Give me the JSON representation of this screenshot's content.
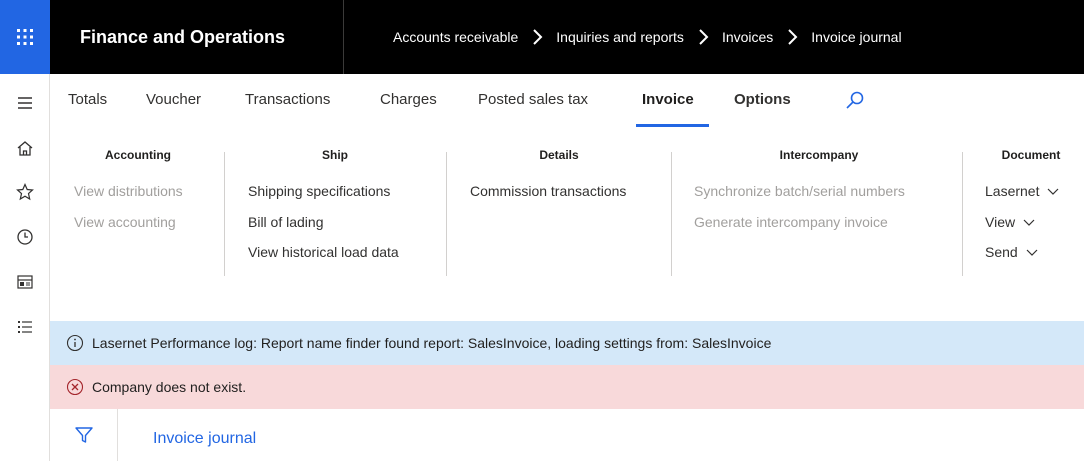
{
  "app": {
    "title": "Finance and Operations"
  },
  "breadcrumb": [
    "Accounts receivable",
    "Inquiries and reports",
    "Invoices",
    "Invoice journal"
  ],
  "tabs": {
    "totals": "Totals",
    "voucher": "Voucher",
    "transactions": "Transactions",
    "charges": "Charges",
    "posted_sales_tax": "Posted sales tax",
    "invoice": "Invoice",
    "options": "Options"
  },
  "groups": {
    "accounting": {
      "title": "Accounting",
      "items": [
        "View distributions",
        "View accounting"
      ]
    },
    "ship": {
      "title": "Ship",
      "items": [
        "Shipping specifications",
        "Bill of lading",
        "View historical load data"
      ]
    },
    "details": {
      "title": "Details",
      "items": [
        "Commission transactions"
      ]
    },
    "intercompany": {
      "title": "Intercompany",
      "items": [
        "Synchronize batch/serial numbers",
        "Generate intercompany invoice"
      ]
    },
    "document": {
      "title": "Document",
      "items": [
        "Lasernet",
        "View",
        "Send"
      ]
    }
  },
  "messages": {
    "info": "Lasernet Performance log: Report name finder found report: SalesInvoice, loading settings from: SalesInvoice",
    "error": "Company does not exist."
  },
  "main": {
    "journal_link": "Invoice journal"
  },
  "colors": {
    "accent": "#2266e3",
    "info_bg": "#d4e8f9",
    "error_bg": "#f8d9da"
  }
}
